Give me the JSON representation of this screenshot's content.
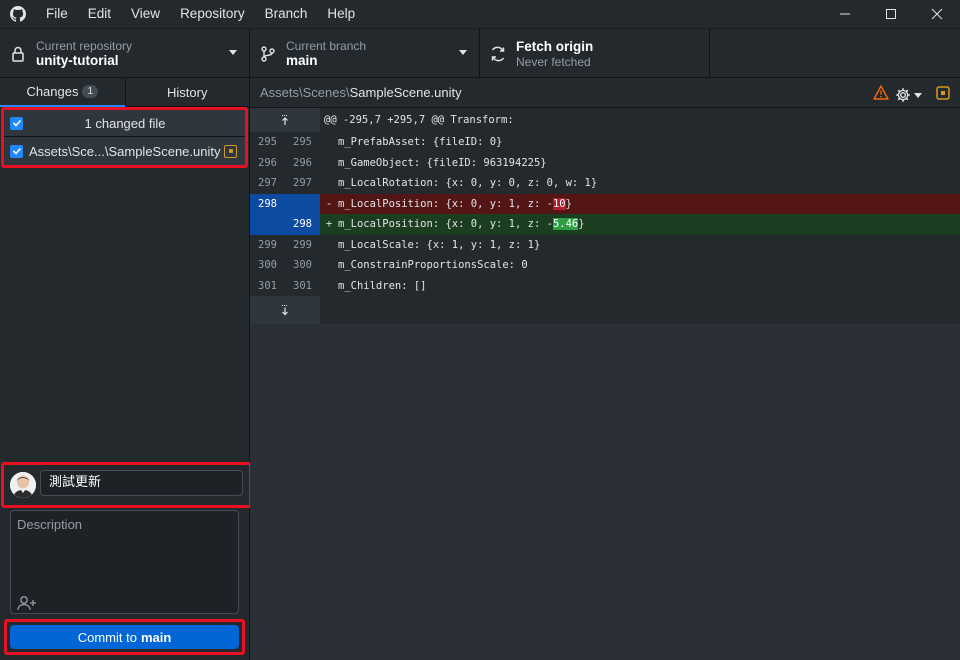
{
  "menu": [
    "File",
    "Edit",
    "View",
    "Repository",
    "Branch",
    "Help"
  ],
  "toolbar": {
    "repo_label": "Current repository",
    "repo_value": "unity-tutorial",
    "branch_label": "Current branch",
    "branch_value": "main",
    "fetch_label": "Fetch origin",
    "fetch_sub": "Never fetched"
  },
  "tabs": {
    "changes": "Changes",
    "changes_count": "1",
    "history": "History"
  },
  "changes": {
    "header": "1 changed file",
    "files": [
      {
        "path": "Assets\\Sce...\\SampleScene.unity",
        "status": "modified"
      }
    ]
  },
  "commit": {
    "summary": "測試更新",
    "description_placeholder": "Description",
    "button_prefix": "Commit to",
    "button_branch": "main"
  },
  "diff": {
    "breadcrumb_dir": "Assets\\Scenes\\",
    "breadcrumb_file": "SampleScene.unity",
    "hunk": "@@ -295,7 +295,7 @@ Transform:",
    "lines": [
      {
        "type": "ctx",
        "old": "295",
        "new": "295",
        "text": "m_PrefabAsset: {fileID: 0}"
      },
      {
        "type": "ctx",
        "old": "296",
        "new": "296",
        "text": "m_GameObject: {fileID: 963194225}"
      },
      {
        "type": "ctx",
        "old": "297",
        "new": "297",
        "text": "m_LocalRotation: {x: 0, y: 0, z: 0, w: 1}"
      },
      {
        "type": "del",
        "old": "298",
        "new": "",
        "marker": "-",
        "text_pre": "m_LocalPosition: {x: 0, y: 1, z: -",
        "text_hl": "10",
        "text_post": "}"
      },
      {
        "type": "add",
        "old": "",
        "new": "298",
        "marker": "+",
        "text_pre": "m_LocalPosition: {x: 0, y: 1, z: -",
        "text_hl": "5.46",
        "text_post": "}"
      },
      {
        "type": "ctx",
        "old": "299",
        "new": "299",
        "text": "m_LocalScale: {x: 1, y: 1, z: 1}"
      },
      {
        "type": "ctx",
        "old": "300",
        "new": "300",
        "text": "m_ConstrainProportionsScale: 0"
      },
      {
        "type": "ctx",
        "old": "301",
        "new": "301",
        "text": "m_Children: []"
      }
    ]
  },
  "colors": {
    "accent": "#0366d6",
    "highlight_border": "#e81123",
    "modified": "#d29922",
    "warning": "#f66a0a"
  },
  "icons": [
    "github-logo-icon",
    "lock-icon",
    "branch-icon",
    "sync-icon",
    "warning-icon",
    "gear-icon",
    "expand-up-icon",
    "expand-down-icon",
    "add-coauthor-icon"
  ]
}
